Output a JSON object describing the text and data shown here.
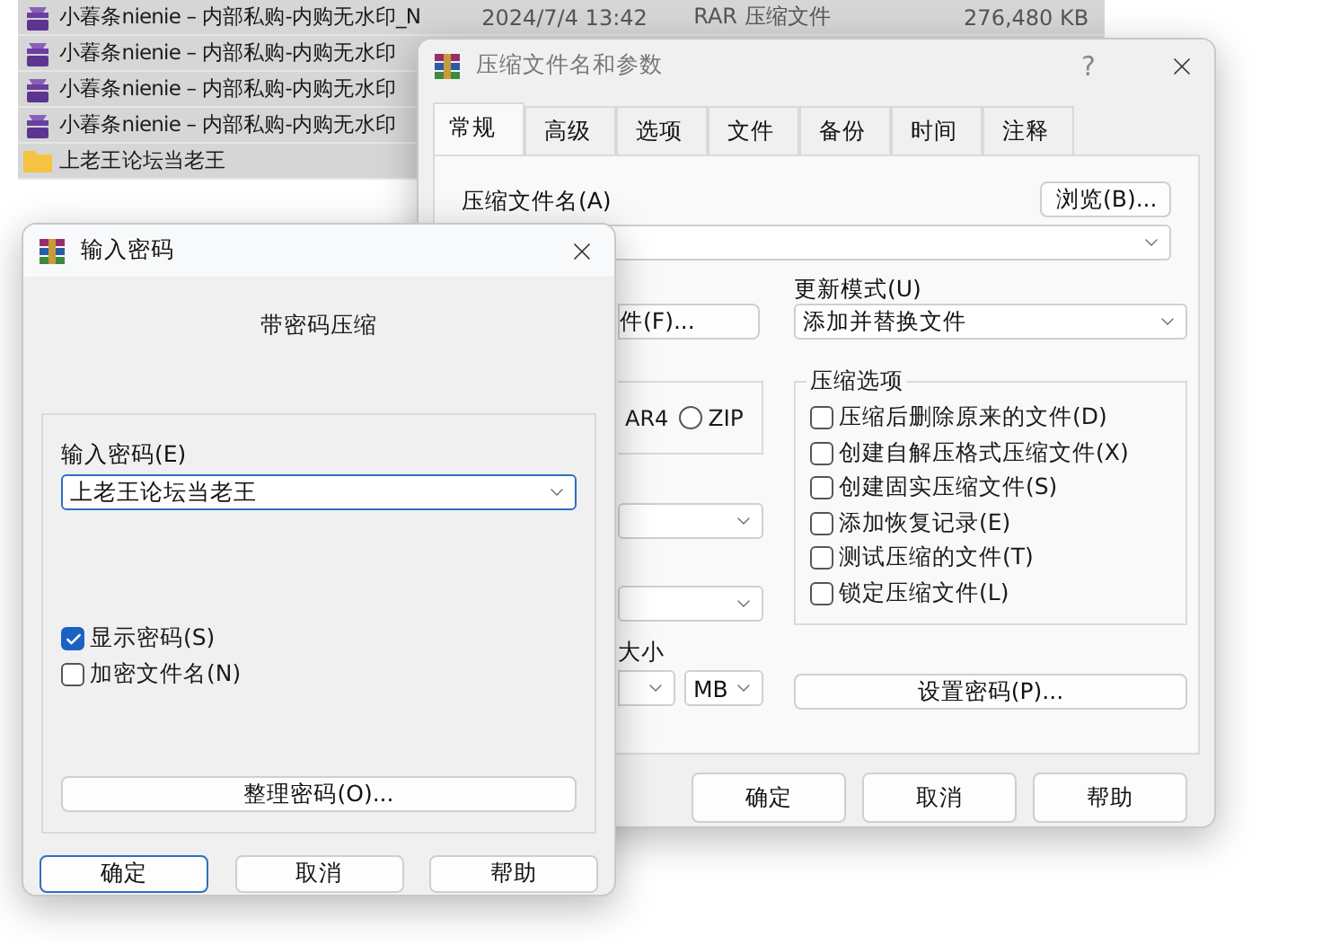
{
  "explorer": {
    "rows": [
      {
        "kind": "rar",
        "name": "小萶条nienie – 内部私购-内购无水印_N",
        "date": "2024/7/4 13:42",
        "type": "RAR 压缩文件",
        "size": "276,480 KB"
      },
      {
        "kind": "rar",
        "name": "小萶条nienie – 内部私购-内购无水印"
      },
      {
        "kind": "rar",
        "name": "小萶条nienie – 内部私购-内购无水印"
      },
      {
        "kind": "rar",
        "name": "小萶条nienie – 内部私购-内购无水印"
      },
      {
        "kind": "folder",
        "name": "上老王论坛当老王"
      }
    ]
  },
  "archive_dialog": {
    "title": "压缩文件名和参数",
    "help": "?",
    "tabs": [
      {
        "label": "常规",
        "selected": true
      },
      {
        "label": "高级",
        "selected": false
      },
      {
        "label": "选项",
        "selected": false
      },
      {
        "label": "文件",
        "selected": false
      },
      {
        "label": "备份",
        "selected": false
      },
      {
        "label": "时间",
        "selected": false
      },
      {
        "label": "注释",
        "selected": false
      }
    ],
    "archive_name_label": "压缩文件名(A)",
    "browse_button": "浏览(B)...",
    "profile_button": "件(F)...",
    "format": {
      "partial_label": "AR4",
      "options": [
        {
          "label": "ZIP",
          "selected": false
        }
      ]
    },
    "update_mode": {
      "label": "更新模式(U)",
      "value": "添加并替换文件"
    },
    "options": {
      "title": "压缩选项",
      "items": [
        {
          "label": "压缩后删除原来的文件(D)",
          "checked": false
        },
        {
          "label": "创建自解压格式压缩文件(X)",
          "checked": false
        },
        {
          "label": "创建固实压缩文件(S)",
          "checked": false
        },
        {
          "label": "添加恢复记录(E)",
          "checked": false
        },
        {
          "label": "测试压缩的文件(T)",
          "checked": false
        },
        {
          "label": "锁定压缩文件(L)",
          "checked": false
        }
      ]
    },
    "split_label": "大小",
    "split_unit": "MB",
    "password_button": "设置密码(P)...",
    "buttons": [
      {
        "label": "确定",
        "default": false
      },
      {
        "label": "取消",
        "default": false
      },
      {
        "label": "帮助",
        "default": false
      }
    ]
  },
  "password_dialog": {
    "title": "输入密码",
    "heading": "带密码压缩",
    "password": {
      "label": "输入密码(E)",
      "value": "上老王论坛当老王"
    },
    "checkboxes": [
      {
        "label": "显示密码(S)",
        "checked": true
      },
      {
        "label": "加密文件名(N)",
        "checked": false
      }
    ],
    "organize_button": "整理密码(O)...",
    "buttons": [
      {
        "label": "确定",
        "default": true
      },
      {
        "label": "取消",
        "default": false
      },
      {
        "label": "帮助",
        "default": false
      }
    ]
  }
}
